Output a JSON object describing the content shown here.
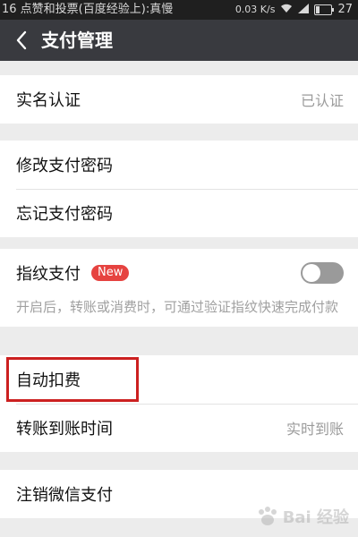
{
  "status_bar": {
    "left_text": "16 点赞和投票(百度经验上):真慢",
    "speed": "0.03 K/s",
    "battery": "27",
    "battery_level": 0.27
  },
  "header": {
    "title": "支付管理"
  },
  "group1": {
    "realname_label": "实名认证",
    "realname_value": "已认证"
  },
  "group2": {
    "modify_password_label": "修改支付密码",
    "forgot_password_label": "忘记支付密码"
  },
  "group3": {
    "fingerprint_label": "指纹支付",
    "new_badge": "New",
    "fingerprint_enabled": false,
    "fingerprint_desc": "开启后，转账或消费时，可通过验证指纹快速完成付款"
  },
  "group4": {
    "auto_deduct_label": "自动扣费",
    "transfer_time_label": "转账到账时间",
    "transfer_time_value": "实时到账"
  },
  "group5": {
    "cancel_pay_label": "注销微信支付"
  },
  "watermark": {
    "text": "Bai 经验"
  },
  "colors": {
    "header_bg": "#393a3f",
    "status_bg": "#1f1f1f",
    "badge_red": "#e64340",
    "highlight_red": "#cc2020"
  }
}
